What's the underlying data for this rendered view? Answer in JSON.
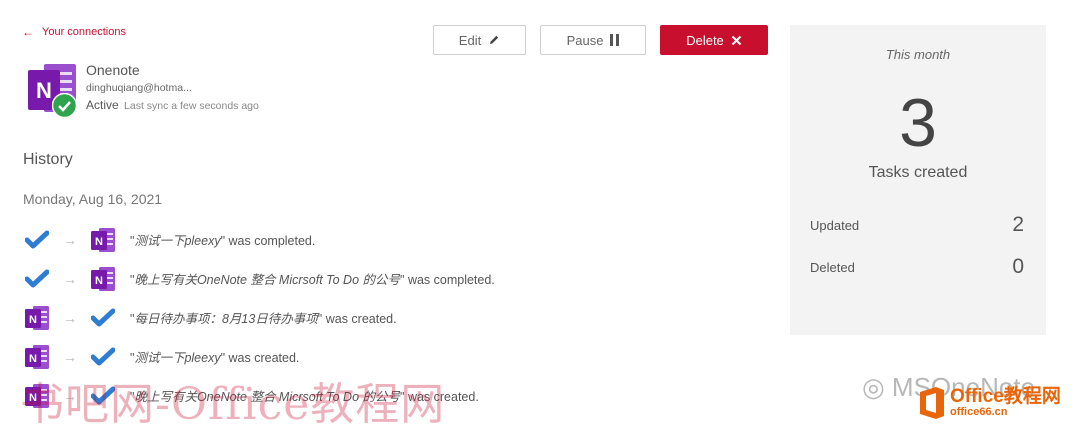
{
  "header": {
    "back_label": "Your connections",
    "edit_label": "Edit",
    "pause_label": "Pause",
    "delete_label": "Delete"
  },
  "connection": {
    "name": "Onenote",
    "email": "dinghuqiang@hotma...",
    "status": "Active",
    "last_sync": "Last sync a few seconds ago"
  },
  "history": {
    "title": "History",
    "date": "Monday, Aug 16, 2021",
    "items": [
      {
        "from": "todo-icon",
        "to": "onenote-icon",
        "quoted": "测试一下pleexy",
        "action": "was completed."
      },
      {
        "from": "todo-icon",
        "to": "onenote-icon",
        "quoted": "晚上写有关OneNote 整合 Micrsoft To Do 的公号",
        "action": "was completed."
      },
      {
        "from": "onenote-icon",
        "to": "todo-icon",
        "quoted": "每日待办事项：8月13日待办事项",
        "action": "was created."
      },
      {
        "from": "onenote-icon",
        "to": "todo-icon",
        "quoted": "测试一下pleexy",
        "action": "was created."
      },
      {
        "from": "onenote-icon",
        "to": "todo-icon",
        "quoted": "晚上写有关OneNote 整合 Micrsoft To Do 的公号",
        "action": "was created."
      }
    ]
  },
  "stats": {
    "period": "This month",
    "tasks_created": "3",
    "tasks_created_label": "Tasks created",
    "updated_label": "Updated",
    "updated_value": "2",
    "deleted_label": "Deleted",
    "deleted_value": "0"
  },
  "watermark": {
    "left": "书吧网-Office教程网",
    "right_text": "MSOneNote",
    "logo_line1": "Office教程网",
    "logo_line2": "office66.cn"
  },
  "colors": {
    "accent": "#c8102e",
    "onenote": "#7719aa",
    "todo": "#2f7cd3",
    "check_green": "#2ea44f",
    "panel": "#f3f3f3"
  }
}
